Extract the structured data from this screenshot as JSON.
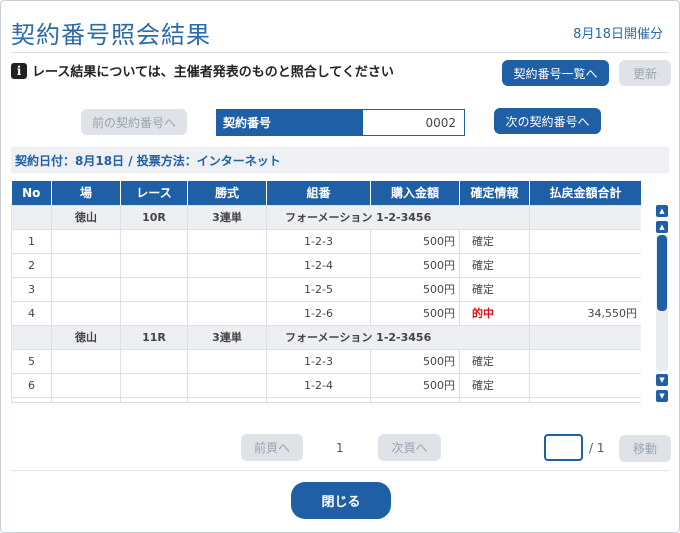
{
  "page": {
    "title": "契約番号照会結果",
    "date_note": "8月18日開催分",
    "notice": "レース結果については、主催者発表のものと照合してください"
  },
  "buttons": {
    "contract_list": "契約番号一覧へ",
    "refresh": "更新",
    "prev_contract": "前の契約番号へ",
    "next_contract": "次の契約番号へ",
    "prev_page": "前頁へ",
    "next_page": "次頁へ",
    "move": "移動",
    "close": "閉じる"
  },
  "contract": {
    "label": "契約番号",
    "value": "0002"
  },
  "meta": "契約日付：8月18日 / 投票方法：インターネット",
  "table": {
    "headers": [
      "No",
      "場",
      "レース",
      "勝式",
      "組番",
      "購入金額",
      "確定情報",
      "払戻金額合計"
    ],
    "groups": [
      {
        "venue": "徳山",
        "race": "10R",
        "bet_type": "3連単",
        "combo": "フォーメーション  1-2-3456",
        "rows": [
          {
            "no": "1",
            "combo": "1-2-3",
            "amount": "500円",
            "status": "確定",
            "payout": ""
          },
          {
            "no": "2",
            "combo": "1-2-4",
            "amount": "500円",
            "status": "確定",
            "payout": ""
          },
          {
            "no": "3",
            "combo": "1-2-5",
            "amount": "500円",
            "status": "確定",
            "payout": ""
          },
          {
            "no": "4",
            "combo": "1-2-6",
            "amount": "500円",
            "status": "的中",
            "payout": "34,550円"
          }
        ]
      },
      {
        "venue": "徳山",
        "race": "11R",
        "bet_type": "3連単",
        "combo": "フォーメーション  1-2-3456",
        "rows": [
          {
            "no": "5",
            "combo": "1-2-3",
            "amount": "500円",
            "status": "確定",
            "payout": ""
          },
          {
            "no": "6",
            "combo": "1-2-4",
            "amount": "500円",
            "status": "確定",
            "payout": ""
          },
          {
            "no": "",
            "combo": "",
            "amount": "",
            "status": "",
            "payout": ""
          }
        ]
      }
    ]
  },
  "pager": {
    "current": "1",
    "total": "/ 1"
  }
}
